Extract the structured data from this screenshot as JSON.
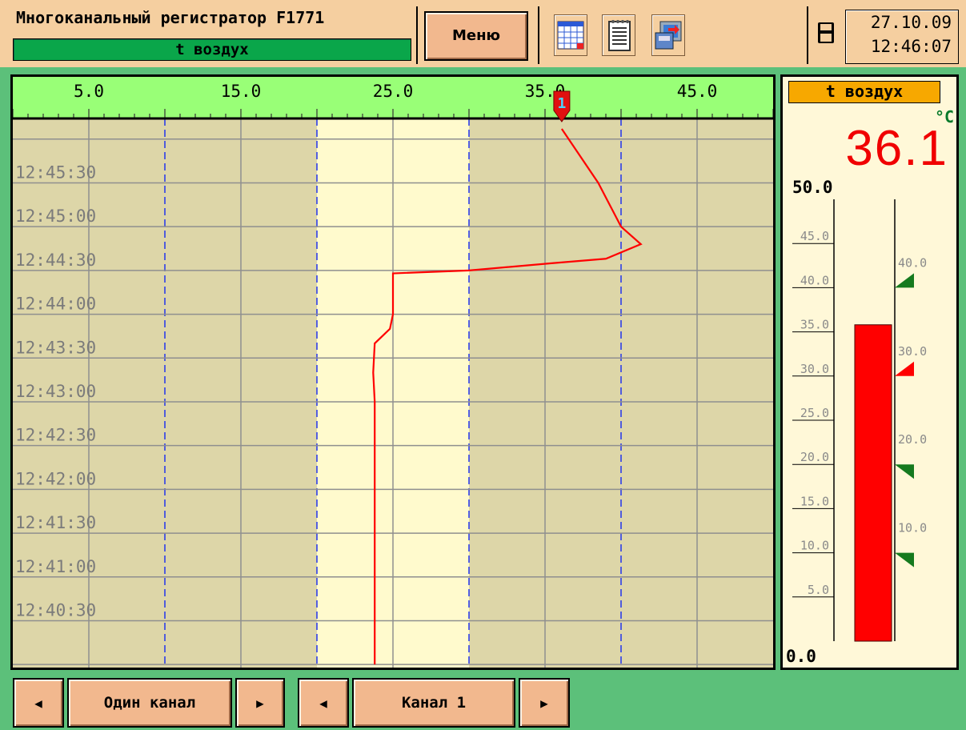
{
  "header": {
    "title": "Многоканальный регистратор F1771",
    "channel_name": "t воздух",
    "menu_label": "Меню",
    "date": "27.10.09",
    "time": "12:46:07",
    "tools": [
      "calendar-icon",
      "notepad-icon",
      "archive-icon"
    ],
    "status_icon": "floppy-disk-icon"
  },
  "chart_data": {
    "type": "line",
    "orientation": "vertical-time",
    "x_axis": {
      "min": 0,
      "max": 50,
      "tick_labels": [
        "5.0",
        "15.0",
        "25.0",
        "35.0",
        "45.0"
      ]
    },
    "time_labels": [
      "12:45:30",
      "12:45:00",
      "12:44:30",
      "12:44:00",
      "12:43:30",
      "12:43:00",
      "12:42:30",
      "12:42:00",
      "12:41:30",
      "12:41:00",
      "12:40:30"
    ],
    "alarm_zone": [
      20,
      30
    ],
    "dashed_lines": [
      10,
      20,
      30,
      40
    ],
    "marker_label": "1",
    "series": [
      {
        "line_color": "#ff0000",
        "points": [
          [
            36.1,
            "12:46:07"
          ],
          [
            38.5,
            "12:45:30"
          ],
          [
            40.0,
            "12:45:00"
          ],
          [
            41.3,
            "12:44:48"
          ],
          [
            39.0,
            "12:44:38"
          ],
          [
            35.5,
            "12:44:35"
          ],
          [
            30.0,
            "12:44:30"
          ],
          [
            25.0,
            "12:44:28"
          ],
          [
            25.0,
            "12:44:00"
          ],
          [
            24.8,
            "12:43:50"
          ],
          [
            23.8,
            "12:43:40"
          ],
          [
            23.7,
            "12:43:20"
          ],
          [
            23.8,
            "12:43:00"
          ],
          [
            23.8,
            "12:40:00"
          ]
        ]
      }
    ]
  },
  "panel": {
    "title": "t воздух",
    "unit": "°C",
    "value": "36.1",
    "scale_max_label": "50.0",
    "scale_min_label": "0.0",
    "scale_max": 50,
    "bar_value": 35.8,
    "bar_color": "#ff0000",
    "scale_labels": [
      {
        "v": 45,
        "t": "45.0"
      },
      {
        "v": 40,
        "t": "40.0"
      },
      {
        "v": 35,
        "t": "35.0"
      },
      {
        "v": 30,
        "t": "30.0"
      },
      {
        "v": 25,
        "t": "25.0"
      },
      {
        "v": 20,
        "t": "20.0"
      },
      {
        "v": 15,
        "t": "15.0"
      },
      {
        "v": 10,
        "t": "10.0"
      },
      {
        "v": 5,
        "t": "5.0"
      }
    ],
    "setpoints": [
      {
        "v": 40,
        "t": "40.0",
        "color": "#157a1e",
        "dir": "up"
      },
      {
        "v": 30,
        "t": "30.0",
        "color": "#ff0000",
        "dir": "up"
      },
      {
        "v": 20,
        "t": "20.0",
        "color": "#157a1e",
        "dir": "down"
      },
      {
        "v": 10,
        "t": "10.0",
        "color": "#157a1e",
        "dir": "down"
      }
    ]
  },
  "nav": {
    "mode_label": "Один канал",
    "channel_label": "Канал 1"
  },
  "colors": {
    "header_bg": "#f5cfa0",
    "channel_bar": "#0aa64a",
    "chart_bg": "#ddd6a8",
    "zone_bg": "#fffacd",
    "axis_bg": "#99ff77",
    "body_bg": "#5cc07a"
  }
}
